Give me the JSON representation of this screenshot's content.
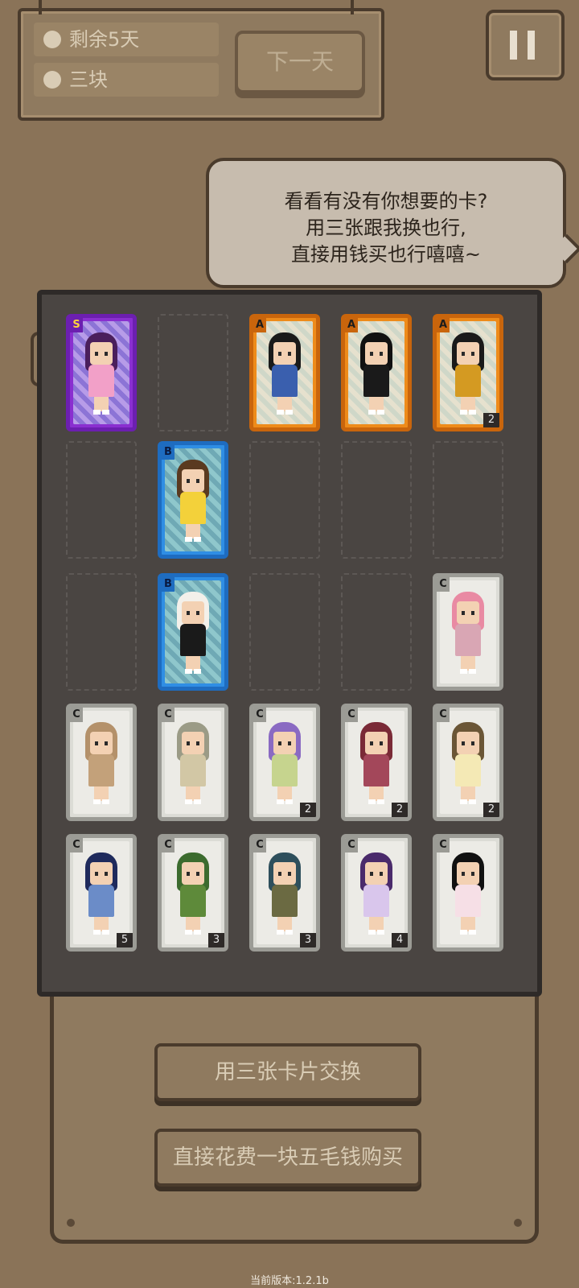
{
  "hud": {
    "days_left": "剩余5天",
    "money": "三块",
    "next_day": "下一天"
  },
  "dialog": {
    "line1": "看看有没有你想要的卡?",
    "line2": "用三张跟我换也行,",
    "line3": "直接用钱买也行嘻嘻~"
  },
  "grid": [
    {
      "rank": "S",
      "count": "",
      "hair": "#4a1f5c",
      "body": "#f2a0c8"
    },
    null,
    {
      "rank": "A",
      "count": "",
      "hair": "#1a1a1a",
      "body": "#3a5fae"
    },
    {
      "rank": "A",
      "count": "",
      "hair": "#111111",
      "body": "#1a1a1a"
    },
    {
      "rank": "A",
      "count": "2",
      "hair": "#1a1a1a",
      "body": "#d49a22"
    },
    null,
    {
      "rank": "B",
      "count": "",
      "hair": "#5a3a20",
      "body": "#f3d13a"
    },
    null,
    null,
    null,
    null,
    {
      "rank": "B",
      "count": "",
      "hair": "#f3f0ea",
      "body": "#1a1a1a"
    },
    null,
    null,
    {
      "rank": "C",
      "count": "",
      "hair": "#e98aa3",
      "body": "#d9a6b4"
    },
    {
      "rank": "C",
      "count": "",
      "hair": "#b4916a",
      "body": "#c3a17a"
    },
    {
      "rank": "C",
      "count": "",
      "hair": "#9b9b86",
      "body": "#d2c7a5"
    },
    {
      "rank": "C",
      "count": "2",
      "hair": "#8a6ac2",
      "body": "#c6d48e"
    },
    {
      "rank": "C",
      "count": "2",
      "hair": "#7a2a36",
      "body": "#a3475a"
    },
    {
      "rank": "C",
      "count": "2",
      "hair": "#6b5636",
      "body": "#f4e9b5"
    },
    {
      "rank": "C",
      "count": "5",
      "hair": "#1f2a5c",
      "body": "#6b8cc8"
    },
    {
      "rank": "C",
      "count": "3",
      "hair": "#3c6b2e",
      "body": "#5e8a3a"
    },
    {
      "rank": "C",
      "count": "3",
      "hair": "#2e4f5c",
      "body": "#6b6a42"
    },
    {
      "rank": "C",
      "count": "4",
      "hair": "#4a2a6b",
      "body": "#d9c6ec"
    },
    {
      "rank": "C",
      "count": "",
      "hair": "#111111",
      "body": "#f6dfe6"
    }
  ],
  "actions": {
    "trade": "用三张卡片交换",
    "buy": "直接花费一块五毛钱购买"
  },
  "version": "当前版本:1.2.1b"
}
